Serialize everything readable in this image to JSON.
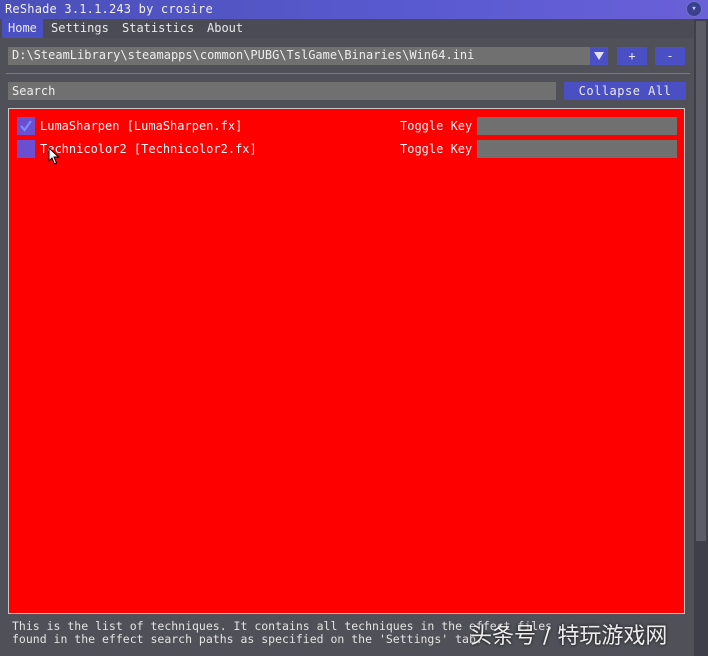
{
  "window": {
    "title": "ReShade 3.1.1.243 by crosire"
  },
  "menu": {
    "items": [
      "Home",
      "Settings",
      "Statistics",
      "About"
    ],
    "active": "Home"
  },
  "preset": {
    "path": "D:\\SteamLibrary\\steamapps\\common\\PUBG\\TslGame\\Binaries\\Win64.ini",
    "add_label": "+",
    "remove_label": "-"
  },
  "search": {
    "placeholder": "Search",
    "collapse_all_label": "Collapse All"
  },
  "techniques": [
    {
      "name": "LumaSharpen [LumaSharpen.fx]",
      "enabled": true,
      "toggle_label": "Toggle Key",
      "key": ""
    },
    {
      "name": "Technicolor2 [Technicolor2.fx]",
      "enabled": false,
      "toggle_label": "Toggle Key",
      "key": ""
    }
  ],
  "status_lines": [
    "This is the list of techniques. It contains all techniques in the effect files",
    "found in the effect search paths as specified on the 'Settings' tab."
  ],
  "watermark": "头条号 / 特玩游戏网",
  "colors": {
    "accent": "#4a4fc4",
    "panel_highlight": "#ff0000",
    "field": "#707070",
    "checkbox": "#6a4fd0"
  }
}
